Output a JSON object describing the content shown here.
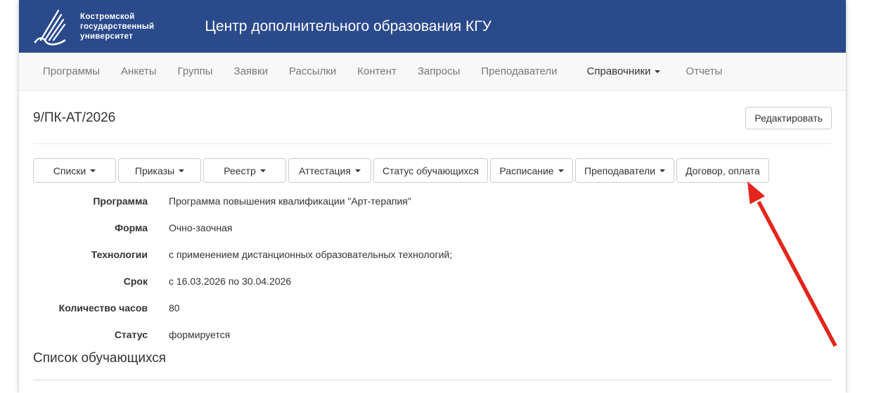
{
  "header": {
    "logo_lines": "Костромской\nгосударственный\nуниверситет",
    "title": "Центр дополнительного образования КГУ"
  },
  "nav": {
    "items": [
      {
        "label": "Программы"
      },
      {
        "label": "Анкеты"
      },
      {
        "label": "Группы"
      },
      {
        "label": "Заявки"
      },
      {
        "label": "Рассылки"
      },
      {
        "label": "Контент"
      },
      {
        "label": "Запросы"
      },
      {
        "label": "Преподаватели"
      },
      {
        "label": "Справочники",
        "dropdown": true
      },
      {
        "label": "Отчеты"
      }
    ]
  },
  "page": {
    "title": "9/ПК-АТ/2026",
    "edit_button": "Редактировать"
  },
  "toolbar": {
    "buttons": [
      {
        "label": "Списки",
        "dropdown": true
      },
      {
        "label": "Приказы",
        "dropdown": true
      },
      {
        "label": "Реестр",
        "dropdown": true
      },
      {
        "label": "Аттестация",
        "dropdown": true
      },
      {
        "label": "Статус обучающихся",
        "dropdown": false
      },
      {
        "label": "Расписание",
        "dropdown": true
      },
      {
        "label": "Преподаватели",
        "dropdown": true
      },
      {
        "label": "Договор, оплата",
        "dropdown": false
      }
    ]
  },
  "details": {
    "rows": [
      {
        "label": "Программа",
        "value": "Программа повышения квалификации \"Арт-терапия\""
      },
      {
        "label": "Форма",
        "value": "Очно-заочная"
      },
      {
        "label": "Технологии",
        "value": "с применением дистанционных образовательных технологий;"
      },
      {
        "label": "Срок",
        "value": "с 16.03.2026 по 30.04.2026"
      },
      {
        "label": "Количество часов",
        "value": "80"
      },
      {
        "label": "Статус",
        "value": "формируется"
      }
    ]
  },
  "section": {
    "students_heading": "Список обучающихся"
  },
  "annotation": {
    "type": "red-arrow",
    "points_to": "Договор, оплата",
    "color": "#e4251b"
  },
  "colors": {
    "header_bg": "#2a4a8c",
    "nav_bg": "#f8f8f8",
    "nav_text": "#777777",
    "button_border": "#cccccc",
    "text": "#333333",
    "arrow": "#e4251b"
  }
}
